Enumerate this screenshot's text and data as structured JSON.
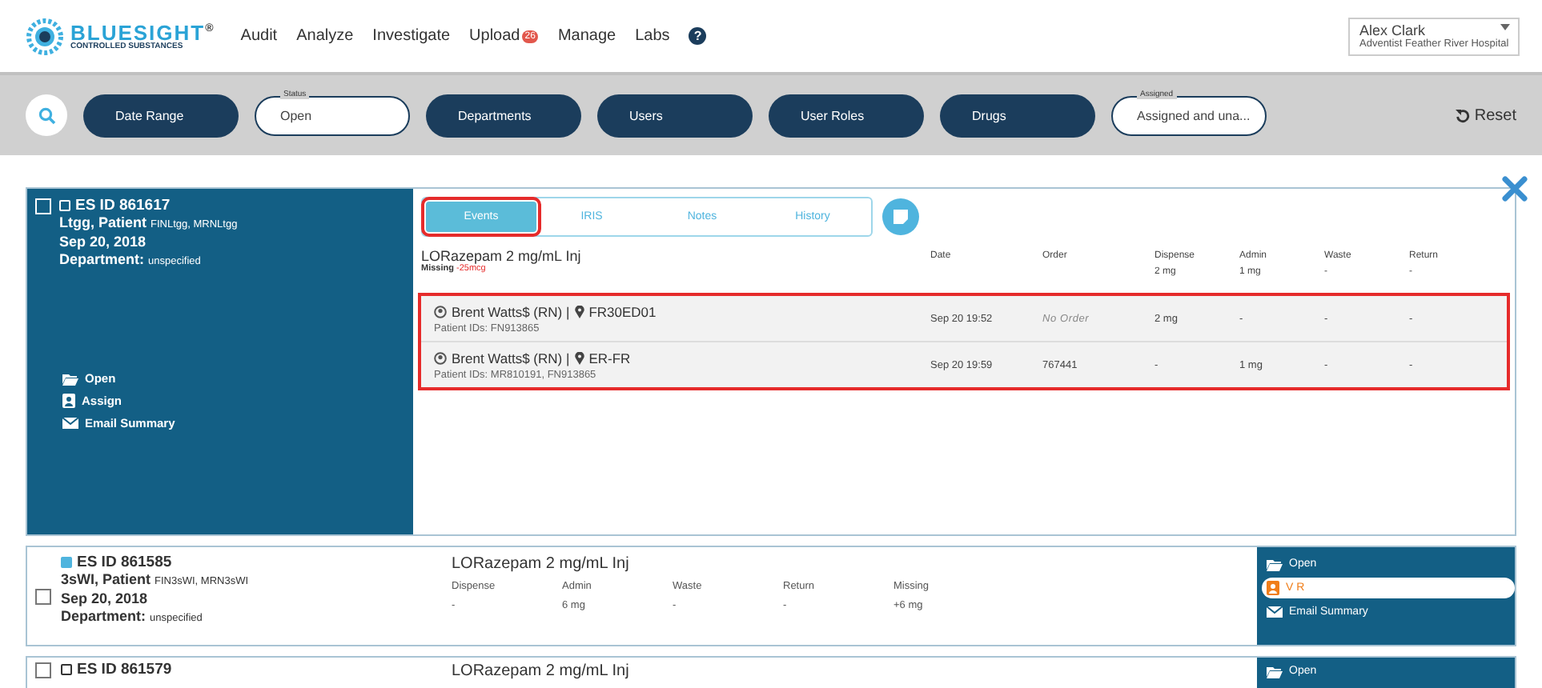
{
  "nav": {
    "logo": {
      "name": "BLUESIGHT",
      "mark": "®",
      "tagline": "CONTROLLED SUBSTANCES"
    },
    "items": [
      {
        "label": "Audit"
      },
      {
        "label": "Analyze"
      },
      {
        "label": "Investigate"
      },
      {
        "label": "Upload",
        "badge": "26"
      },
      {
        "label": "Manage"
      },
      {
        "label": "Labs"
      }
    ],
    "help": "?",
    "user": {
      "name": "Alex Clark",
      "org": "Adventist Feather River Hospital"
    }
  },
  "filters": [
    {
      "kind": "button",
      "label": "Date Range"
    },
    {
      "kind": "field",
      "legend": "Status",
      "value": "Open"
    },
    {
      "kind": "button",
      "label": "Departments"
    },
    {
      "kind": "button",
      "label": "Users"
    },
    {
      "kind": "button",
      "label": "User Roles"
    },
    {
      "kind": "button",
      "label": "Drugs"
    },
    {
      "kind": "field",
      "legend": "Assigned",
      "value": "Assigned and una..."
    }
  ],
  "reset": "Reset",
  "cases": [
    {
      "expanded": true,
      "checked": false,
      "flagged": false,
      "id": "ES ID 861617",
      "patient": "Ltgg, Patient",
      "patient_ids": "FINLtgg, MRNLtgg",
      "date": "Sep 20, 2018",
      "dept_label": "Department:",
      "dept": "unspecified",
      "actions": [
        {
          "kind": "open",
          "label": "Open",
          "highlighted": false
        },
        {
          "kind": "assign",
          "label": "Assign",
          "highlighted": false
        },
        {
          "kind": "email",
          "label": "Email Summary",
          "highlighted": false
        }
      ],
      "tabs": [
        {
          "label": "Events",
          "selected": true,
          "annotated": true
        },
        {
          "label": "IRIS",
          "selected": false,
          "annotated": false
        },
        {
          "label": "Notes",
          "selected": false,
          "annotated": false
        },
        {
          "label": "History",
          "selected": false,
          "annotated": false
        }
      ],
      "drug": "LORazepam 2 mg/mL Inj",
      "missing_label": "Missing",
      "missing": "-25mcg",
      "columns": [
        {
          "label": "Date"
        },
        {
          "label": "Order"
        },
        {
          "label": "Dispense",
          "total": "2 mg"
        },
        {
          "label": "Admin",
          "total": "1 mg"
        },
        {
          "label": "Waste",
          "total": "-"
        },
        {
          "label": "Return",
          "total": "-"
        }
      ],
      "events_annotated": true,
      "events": [
        {
          "user": "Brent Watts$ (RN)",
          "separator": "|",
          "location": "FR30ED01",
          "patient_ids": "Patient IDs: FN913865",
          "cells": [
            {
              "text": "Sep 20 19:52",
              "italic": false
            },
            {
              "text": "No Order",
              "italic": true
            },
            {
              "text": "2 mg",
              "italic": false
            },
            {
              "text": "-",
              "italic": false
            },
            {
              "text": "-",
              "italic": false
            },
            {
              "text": "-",
              "italic": false
            }
          ]
        },
        {
          "user": "Brent Watts$ (RN)",
          "separator": "|",
          "location": "ER-FR",
          "patient_ids": "Patient IDs: MR810191, FN913865",
          "cells": [
            {
              "text": "Sep 20 19:59",
              "italic": false
            },
            {
              "text": "767441",
              "italic": false
            },
            {
              "text": "-",
              "italic": false
            },
            {
              "text": "1 mg",
              "italic": false
            },
            {
              "text": "-",
              "italic": false
            },
            {
              "text": "-",
              "italic": false
            }
          ]
        }
      ]
    },
    {
      "expanded": false,
      "checked": false,
      "flagged": true,
      "id": "ES ID 861585",
      "patient": "3sWI, Patient",
      "patient_ids": "FIN3sWI, MRN3sWI",
      "date": "Sep 20, 2018",
      "dept_label": "Department:",
      "dept": "unspecified",
      "drug": "LORazepam 2 mg/mL Inj",
      "summary": [
        {
          "label": "Dispense",
          "value": "-"
        },
        {
          "label": "Admin",
          "value": "6 mg"
        },
        {
          "label": "Waste",
          "value": "-"
        },
        {
          "label": "Return",
          "value": "-"
        },
        {
          "label": "Missing",
          "value": "+6 mg"
        }
      ],
      "actions": [
        {
          "kind": "open",
          "label": "Open",
          "highlighted": false
        },
        {
          "kind": "assign",
          "label": "V R",
          "highlighted": true
        },
        {
          "kind": "email",
          "label": "Email Summary",
          "highlighted": false
        }
      ]
    },
    {
      "expanded": false,
      "checked": false,
      "flagged": false,
      "id": "ES ID 861579",
      "drug": "LORazepam 2 mg/mL Inj",
      "actions": [
        {
          "kind": "open",
          "label": "Open",
          "highlighted": false
        }
      ]
    }
  ]
}
